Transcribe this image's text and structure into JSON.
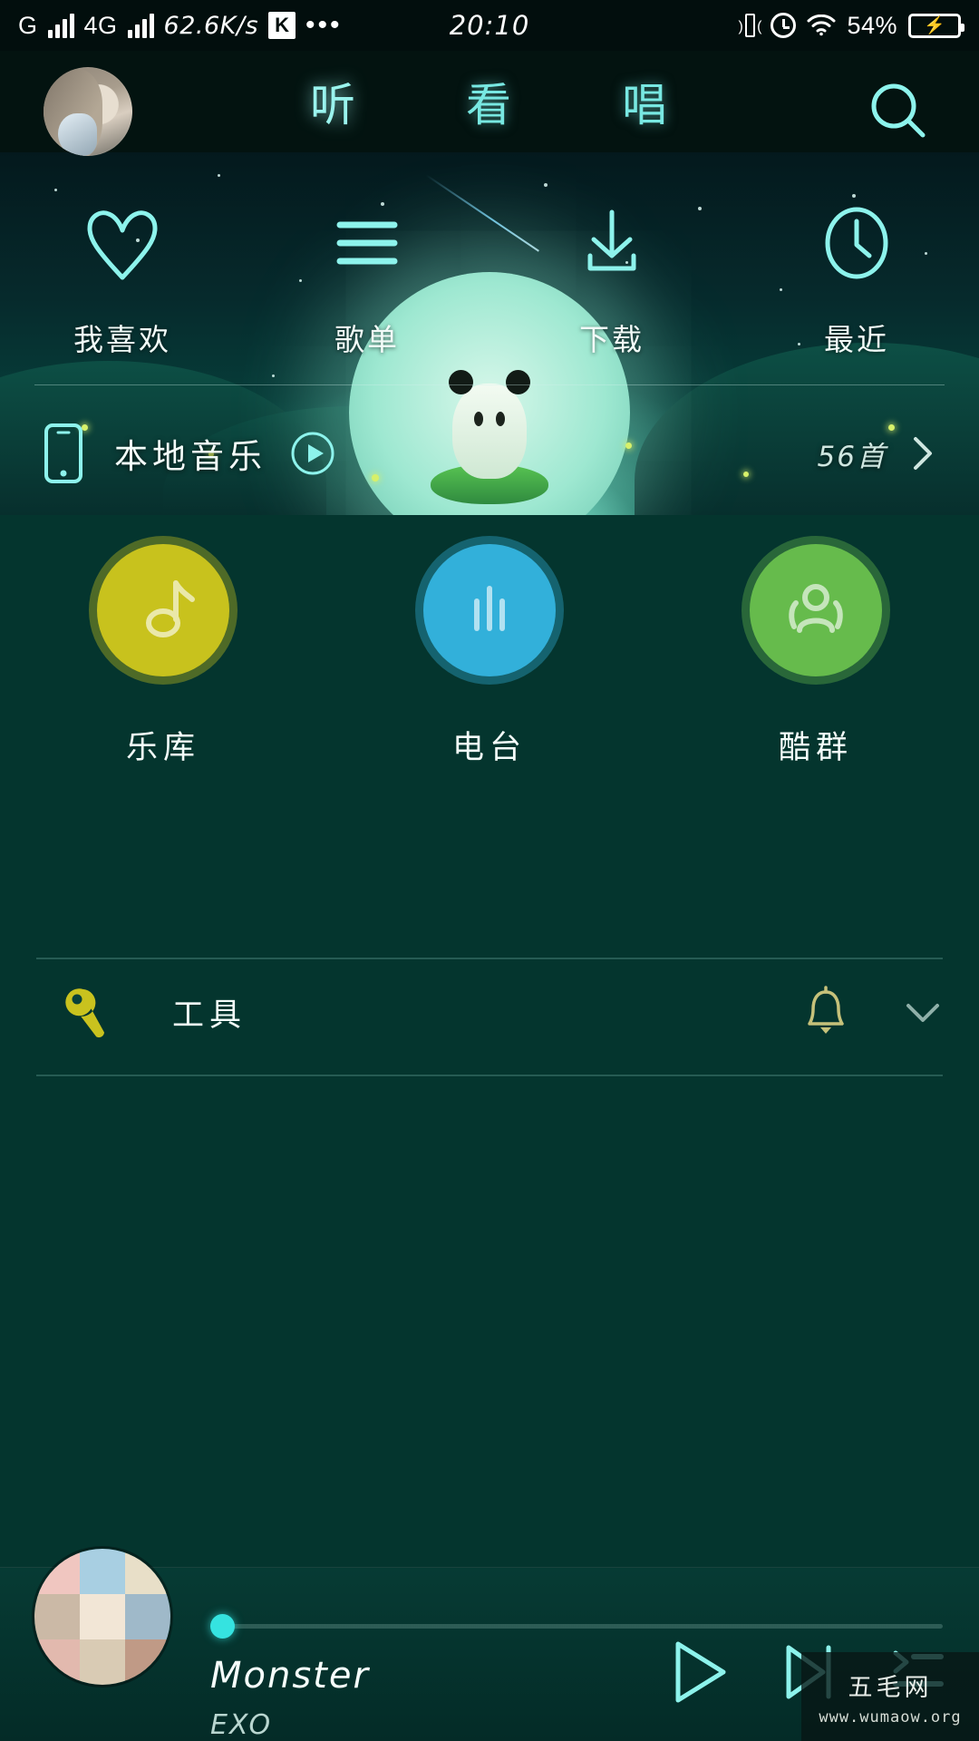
{
  "status_bar": {
    "sim1_label": "G",
    "sim2_label": "4G",
    "net_speed": "62.6K/s",
    "app_badge": "K",
    "overflow": "•••",
    "clock": "20:10",
    "battery_percent": "54%",
    "icons": {
      "vibrate": "vibrate-icon",
      "alarm": "alarm-icon",
      "wifi": "wifi-icon",
      "battery": "battery-charging-icon"
    }
  },
  "top_nav": {
    "avatar": "user-avatar",
    "tabs": [
      {
        "label": "听",
        "active": true
      },
      {
        "label": "看",
        "active": false
      },
      {
        "label": "唱",
        "active": false
      }
    ],
    "search_icon": "search-icon"
  },
  "banner": {
    "quick_actions": [
      {
        "icon": "heart-icon",
        "label": "我喜欢"
      },
      {
        "icon": "playlist-icon",
        "label": "歌单"
      },
      {
        "icon": "download-icon",
        "label": "下载"
      },
      {
        "icon": "clock-icon",
        "label": "最近"
      }
    ],
    "local_music": {
      "icon": "phone-icon",
      "label": "本地音乐",
      "play_icon": "play-circle-icon",
      "count": "56首",
      "chevron": "chevron-right-icon"
    }
  },
  "categories": [
    {
      "label": "乐库",
      "icon": "music-note-icon",
      "color": "#c9c21e"
    },
    {
      "label": "电台",
      "icon": "equalizer-icon",
      "color": "#33b0da"
    },
    {
      "label": "酷群",
      "icon": "group-icon",
      "color": "#67bb4d"
    }
  ],
  "tools": {
    "wrench_icon": "wrench-icon",
    "label": "工具",
    "bell_icon": "bell-icon",
    "caret_icon": "chevron-down-icon"
  },
  "player": {
    "cover": "album-cover",
    "title": "Monster",
    "artist": "EXO",
    "progress_percent": 0,
    "controls": [
      {
        "name": "play-button",
        "icon": "play-icon"
      },
      {
        "name": "next-button",
        "icon": "skip-next-icon"
      },
      {
        "name": "playlist-button",
        "icon": "queue-list-icon"
      }
    ]
  },
  "watermark": {
    "title": "五毛网",
    "url": "www.wumaow.org"
  },
  "colors": {
    "accent_cyan": "#8df3ec",
    "background": "#04352e",
    "player_bg": "#063b34",
    "progress_knob": "#35e3e0"
  }
}
